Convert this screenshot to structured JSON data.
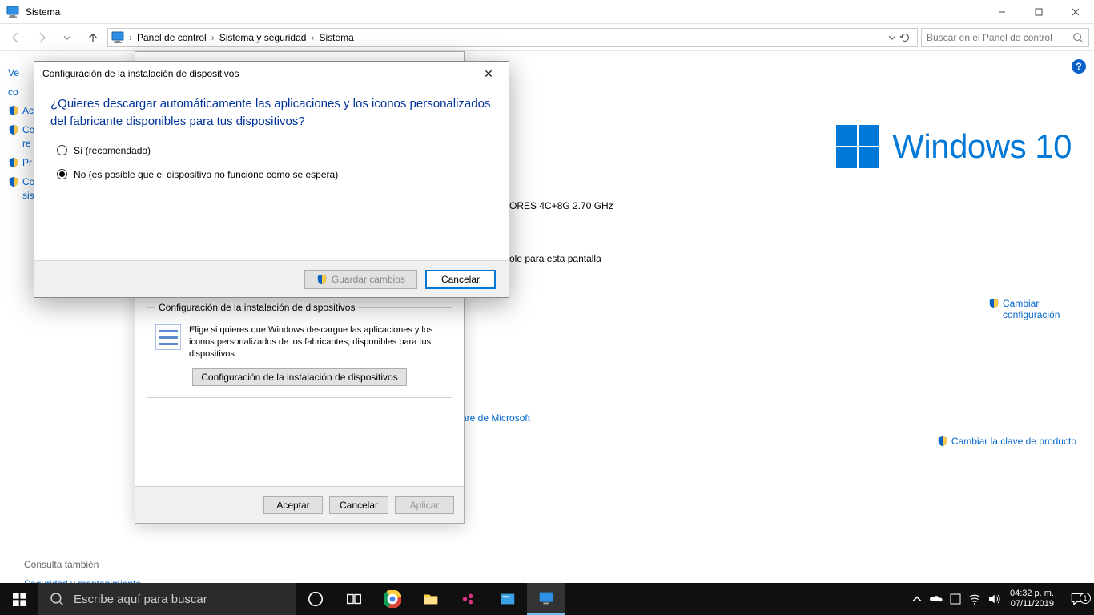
{
  "window": {
    "title": "Sistema"
  },
  "sysbuttons": {
    "min": "–",
    "max": "▢",
    "close": "✕"
  },
  "breadcrumb": [
    "Panel de control",
    "Sistema y seguridad",
    "Sistema"
  ],
  "search": {
    "placeholder": "Buscar en el Panel de control"
  },
  "left_peek": {
    "items": [
      "Ve",
      "co",
      "Ac",
      "Co",
      "re",
      "Pr",
      "Co",
      "sis"
    ]
  },
  "windows_logo_text": "Windows 10",
  "main_peek": {
    "processor": "ORES 4C+8G   2.70 GHz",
    "display": "ole para esta pantalla",
    "ms_link": "are de Microsoft"
  },
  "right_links": {
    "change_config": "Cambiar configuración",
    "change_key": "Cambiar la clave de producto"
  },
  "see_also": {
    "header": "Consulta también",
    "link": "Seguridad y mantenimiento"
  },
  "sysprops": {
    "fieldset_legend": "Configuración de la instalación de dispositivos",
    "fieldset_text": "Elige si quieres que Windows descargue las aplicaciones y los iconos personalizados de los fabricantes, disponibles para tus dispositivos.",
    "fieldset_button": "Configuración de la instalación de dispositivos",
    "btn_ok": "Aceptar",
    "btn_cancel": "Cancelar",
    "btn_apply": "Aplicar"
  },
  "modal": {
    "title": "Configuración de la instalación de dispositivos",
    "question": "¿Quieres descargar automáticamente las aplicaciones y los iconos personalizados del fabricante disponibles para tus dispositivos?",
    "opt_yes": "Sí (recomendado)",
    "opt_no": "No (es posible que el dispositivo no funcione como se espera)",
    "btn_save": "Guardar cambios",
    "btn_cancel": "Cancelar"
  },
  "taskbar": {
    "search_placeholder": "Escribe aquí para buscar",
    "clock_time": "04:32 p. m.",
    "clock_date": "07/11/2019",
    "notif_count": "1"
  }
}
